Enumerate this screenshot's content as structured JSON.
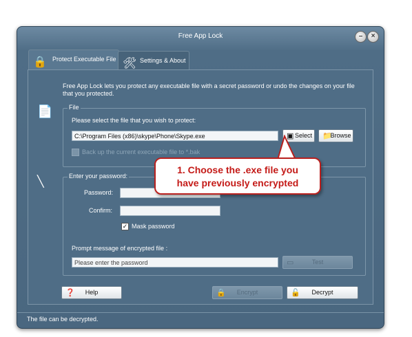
{
  "window": {
    "title": "Free App Lock"
  },
  "tabs": [
    {
      "label": "Protect Executable File",
      "icon": "lock-icon"
    },
    {
      "label": "Settings & About",
      "icon": "tools-icon"
    }
  ],
  "intro_text": "Free App Lock lets you protect any executable file with a secret password or undo the changes on your file that you protected.",
  "file_section": {
    "legend": "File",
    "prompt": "Please select the file that you wish to protect:",
    "path_value": "C:\\Program Files (x86)\\skype\\Phone\\Skype.exe",
    "select_label": "Select",
    "browse_label": "Browse",
    "backup_label": "Back up the current executable file to *.bak",
    "backup_checked": false
  },
  "password_section": {
    "legend": "Enter your password:",
    "password_label": "Password:",
    "confirm_label": "Confirm:",
    "mask_label": "Mask password",
    "mask_checked": true,
    "prompt_label": "Prompt message of encrypted file :",
    "prompt_placeholder": "Please enter the password",
    "test_label": "Test"
  },
  "buttons": {
    "help": "Help",
    "encrypt": "Encrypt",
    "decrypt": "Decrypt"
  },
  "callout": {
    "line1": "1. Choose the .exe file you",
    "line2": "have previously encrypted"
  },
  "status": "The file can be decrypted."
}
